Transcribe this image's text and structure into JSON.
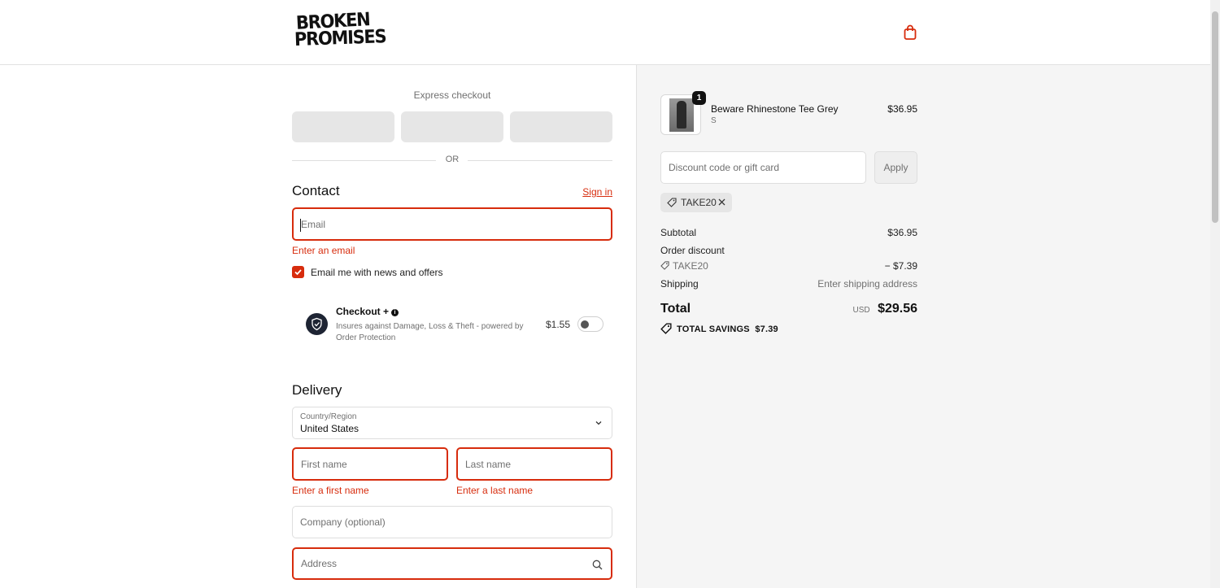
{
  "header": {
    "logo_line1": "BROKEN",
    "logo_line2": "PROMISES",
    "cart_icon": "shopping-bag-icon"
  },
  "express": {
    "label": "Express checkout",
    "or_text": "OR"
  },
  "contact": {
    "title": "Contact",
    "sign_in": "Sign in",
    "email_placeholder": "Email",
    "email_error": "Enter an email",
    "newsletter_label": "Email me with news and offers",
    "newsletter_checked": true
  },
  "protection": {
    "title": "Checkout +",
    "description": "Insures against Damage, Loss & Theft - powered by Order Protection",
    "price": "$1.55",
    "enabled": false
  },
  "delivery": {
    "title": "Delivery",
    "country_label": "Country/Region",
    "country_value": "United States",
    "first_name_placeholder": "First name",
    "first_name_error": "Enter a first name",
    "last_name_placeholder": "Last name",
    "last_name_error": "Enter a last name",
    "company_placeholder": "Company (optional)",
    "address_placeholder": "Address"
  },
  "summary": {
    "product": {
      "quantity": "1",
      "name": "Beware Rhinestone Tee Grey",
      "variant": "S",
      "price": "$36.95"
    },
    "discount_placeholder": "Discount code or gift card",
    "apply_label": "Apply",
    "applied_code": "TAKE20",
    "subtotal_label": "Subtotal",
    "subtotal_value": "$36.95",
    "order_discount_label": "Order discount",
    "discount_code": "TAKE20",
    "discount_value": "− $7.39",
    "shipping_label": "Shipping",
    "shipping_value": "Enter shipping address",
    "total_label": "Total",
    "currency": "USD",
    "total_value": "$29.56",
    "savings_label": "TOTAL SAVINGS",
    "savings_value": "$7.39"
  },
  "colors": {
    "error": "#d72c0d",
    "summary_bg": "#f5f5f5",
    "text": "#1a1a1a"
  }
}
